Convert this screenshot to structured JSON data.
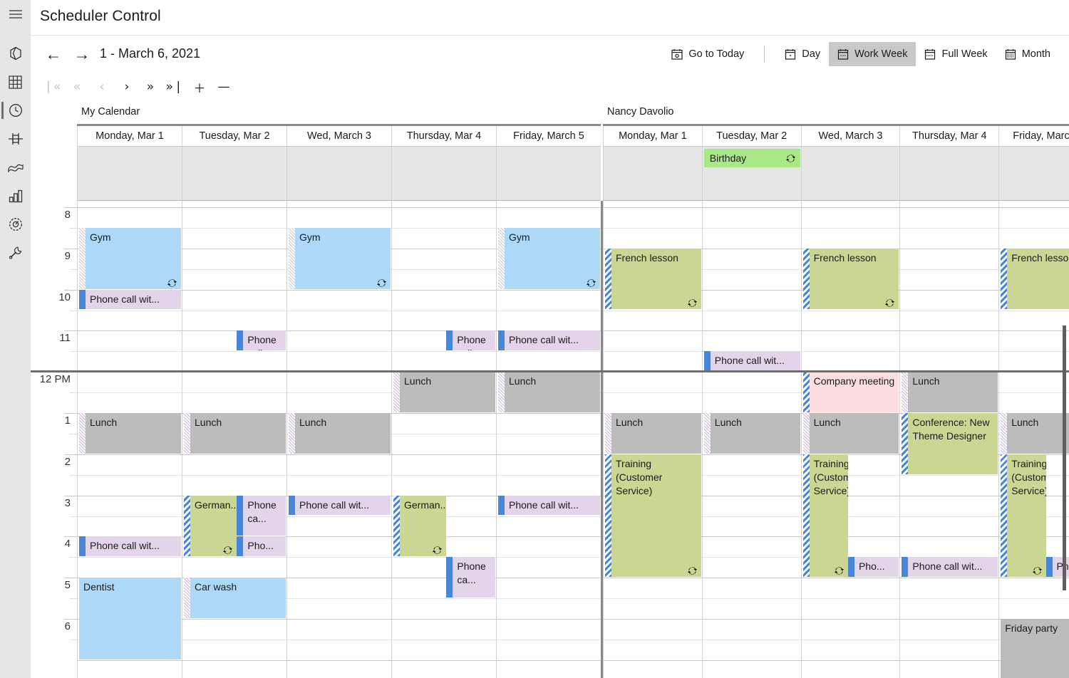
{
  "app": {
    "title": "Scheduler Control"
  },
  "rail": {
    "items": [
      {
        "name": "hamburger-menu-icon",
        "label": "Menu"
      },
      {
        "name": "shapes-icon",
        "label": "Shapes"
      },
      {
        "name": "grid-icon",
        "label": "Grid"
      },
      {
        "name": "clock-icon",
        "label": "Scheduler",
        "selected": true
      },
      {
        "name": "layout-icon",
        "label": "Layout"
      },
      {
        "name": "ribbon-icon",
        "label": "Ribbon"
      },
      {
        "name": "bar-chart-icon",
        "label": "Charts"
      },
      {
        "name": "gauge-icon",
        "label": "Gauge"
      },
      {
        "name": "wrench-icon",
        "label": "Tools"
      }
    ]
  },
  "nav": {
    "prev_label": "←",
    "next_label": "→",
    "range": "1 - March 6, 2021",
    "go_to_today": "Go to Today",
    "views": [
      {
        "label": "Day",
        "icon": "calendar-day-icon",
        "active": false
      },
      {
        "label": "Work Week",
        "icon": "calendar-work-week-icon",
        "active": true
      },
      {
        "label": "Full Week",
        "icon": "calendar-full-week-icon",
        "active": false
      },
      {
        "label": "Month",
        "icon": "calendar-month-icon",
        "active": false
      }
    ]
  },
  "pager": {
    "buttons": [
      {
        "name": "first-page-button",
        "glyph": "❘«",
        "disabled": true
      },
      {
        "name": "prev-block-button",
        "glyph": "«",
        "disabled": true
      },
      {
        "name": "prev-page-button",
        "glyph": "‹",
        "disabled": true
      },
      {
        "name": "next-page-button",
        "glyph": "›",
        "disabled": false
      },
      {
        "name": "next-block-button",
        "glyph": "»",
        "disabled": false
      },
      {
        "name": "last-page-button",
        "glyph": "»❘",
        "disabled": false
      },
      {
        "name": "zoom-in-button",
        "glyph": "＋",
        "disabled": false
      },
      {
        "name": "zoom-out-button",
        "glyph": "—",
        "disabled": false
      }
    ]
  },
  "scheduler": {
    "groups": [
      {
        "id": "mycal",
        "label": "My Calendar"
      },
      {
        "id": "nancy",
        "label": "Nancy Davolio"
      }
    ],
    "days": [
      "Monday, Mar 1",
      "Tuesday, Mar 2",
      "Wed, March 3",
      "Thursday, Mar 4",
      "Friday, March 5"
    ],
    "time_labels": [
      "8",
      "9",
      "10",
      "11",
      "12 PM",
      "1",
      "2",
      "3",
      "4",
      "5",
      "6"
    ],
    "recurrence_icon": "recurrence-icon",
    "colors": {
      "appointment_blue": "#aed8f8",
      "appointment_purple": "#e3d4ea",
      "appointment_gray": "#bcbcbc",
      "appointment_olive": "#ccd693",
      "appointment_pink": "#fbdedd",
      "allday_green": "#a9e887",
      "status_bar_blue": "#4a86d8",
      "selected_view": "#c8c8c8"
    },
    "allday": [
      {
        "group": "nancy",
        "day": 1,
        "title": "Birthday",
        "color": "allday_green",
        "recurring": true
      }
    ],
    "appointments": [
      {
        "group": "mycal",
        "day": 0,
        "title": "Gym",
        "start": "8:30",
        "end": "10:00",
        "color": "blue",
        "bar": "dot-b",
        "recurring": true
      },
      {
        "group": "mycal",
        "day": 2,
        "title": "Gym",
        "start": "8:30",
        "end": "10:00",
        "color": "blue",
        "bar": "dot-b",
        "recurring": true
      },
      {
        "group": "mycal",
        "day": 4,
        "title": "Gym",
        "start": "8:30",
        "end": "10:00",
        "color": "blue",
        "bar": "dot-b",
        "recurring": true
      },
      {
        "group": "mycal",
        "day": 0,
        "title": "Phone call wit...",
        "start": "10:00",
        "end": "10:30",
        "color": "purple",
        "bar": "blue",
        "recurring": false
      },
      {
        "group": "mycal",
        "day": 1,
        "title": "Phone call wit...",
        "start": "11:00",
        "end": "11:30",
        "color": "purple",
        "bar": "blue",
        "recurring": false
      },
      {
        "group": "mycal",
        "day": 3,
        "title": "Phone call wit...",
        "start": "11:00",
        "end": "11:30",
        "color": "purple",
        "bar": "blue",
        "recurring": false
      },
      {
        "group": "mycal",
        "day": 4,
        "title": "Phone call wit...",
        "start": "11:00",
        "end": "11:30",
        "color": "purple",
        "bar": "blue",
        "recurring": false
      },
      {
        "group": "mycal",
        "day": 3,
        "title": "Lunch",
        "start": "12:00",
        "end": "13:00",
        "color": "gray",
        "bar": "dot-p",
        "recurring": false
      },
      {
        "group": "mycal",
        "day": 4,
        "title": "Lunch",
        "start": "12:00",
        "end": "13:00",
        "color": "gray",
        "bar": "dot-p",
        "recurring": false
      },
      {
        "group": "mycal",
        "day": 0,
        "title": "Lunch",
        "start": "13:00",
        "end": "14:00",
        "color": "gray",
        "bar": "dot-p",
        "recurring": false
      },
      {
        "group": "mycal",
        "day": 1,
        "title": "Lunch",
        "start": "13:00",
        "end": "14:00",
        "color": "gray",
        "bar": "dot-p",
        "recurring": false
      },
      {
        "group": "mycal",
        "day": 2,
        "title": "Lunch",
        "start": "13:00",
        "end": "14:00",
        "color": "gray",
        "bar": "dot-p",
        "recurring": false
      },
      {
        "group": "mycal",
        "day": 1,
        "title": "German...",
        "start": "15:00",
        "end": "16:30",
        "color": "olive",
        "bar": "stripe",
        "recurring": true
      },
      {
        "group": "mycal",
        "day": 3,
        "title": "German...",
        "start": "15:00",
        "end": "16:30",
        "color": "olive",
        "bar": "stripe",
        "recurring": true
      },
      {
        "group": "mycal",
        "day": 1,
        "title": "Phone ca...",
        "start": "15:00",
        "end": "16:00",
        "color": "purple",
        "bar": "blue",
        "recurring": false
      },
      {
        "group": "mycal",
        "day": 1,
        "title": "Pho...",
        "start": "16:00",
        "end": "16:30",
        "color": "purple",
        "bar": "blue",
        "recurring": false
      },
      {
        "group": "mycal",
        "day": 2,
        "title": "Phone call wit...",
        "start": "15:00",
        "end": "15:30",
        "color": "purple",
        "bar": "blue",
        "recurring": false
      },
      {
        "group": "mycal",
        "day": 4,
        "title": "Phone call wit...",
        "start": "15:00",
        "end": "15:30",
        "color": "purple",
        "bar": "blue",
        "recurring": false
      },
      {
        "group": "mycal",
        "day": 0,
        "title": "Phone call wit...",
        "start": "16:00",
        "end": "16:30",
        "color": "purple",
        "bar": "blue",
        "recurring": false
      },
      {
        "group": "mycal",
        "day": 3,
        "title": "Phone ca...",
        "start": "16:30",
        "end": "17:30",
        "color": "purple",
        "bar": "blue",
        "recurring": false
      },
      {
        "group": "mycal",
        "day": 0,
        "title": "Dentist",
        "start": "17:00",
        "end": "19:00",
        "color": "blue",
        "bar": "none",
        "recurring": false
      },
      {
        "group": "mycal",
        "day": 1,
        "title": "Car wash",
        "start": "17:00",
        "end": "18:00",
        "color": "blue",
        "bar": "dot-p",
        "recurring": false
      },
      {
        "group": "nancy",
        "day": 0,
        "title": "French lesson",
        "start": "9:00",
        "end": "10:30",
        "color": "olive",
        "bar": "stripe",
        "recurring": true
      },
      {
        "group": "nancy",
        "day": 2,
        "title": "French lesson",
        "start": "9:00",
        "end": "10:30",
        "color": "olive",
        "bar": "stripe",
        "recurring": true
      },
      {
        "group": "nancy",
        "day": 4,
        "title": "French lesson",
        "start": "9:00",
        "end": "10:30",
        "color": "olive",
        "bar": "stripe",
        "recurring": true
      },
      {
        "group": "nancy",
        "day": 1,
        "title": "Phone call wit...",
        "start": "11:30",
        "end": "12:00",
        "color": "purple",
        "bar": "blue",
        "recurring": false
      },
      {
        "group": "nancy",
        "day": 2,
        "title": "Company meeting",
        "start": "12:00",
        "end": "13:00",
        "color": "pink",
        "bar": "stripe",
        "recurring": false
      },
      {
        "group": "nancy",
        "day": 3,
        "title": "Lunch",
        "start": "12:00",
        "end": "13:00",
        "color": "gray",
        "bar": "dot-p",
        "recurring": false
      },
      {
        "group": "nancy",
        "day": 0,
        "title": "Lunch",
        "start": "13:00",
        "end": "14:00",
        "color": "gray",
        "bar": "dot-p",
        "recurring": false
      },
      {
        "group": "nancy",
        "day": 1,
        "title": "Lunch",
        "start": "13:00",
        "end": "14:00",
        "color": "gray",
        "bar": "dot-p",
        "recurring": false
      },
      {
        "group": "nancy",
        "day": 2,
        "title": "Lunch",
        "start": "13:00",
        "end": "14:00",
        "color": "gray",
        "bar": "dot-p",
        "recurring": false
      },
      {
        "group": "nancy",
        "day": 4,
        "title": "Lunch",
        "start": "13:00",
        "end": "14:00",
        "color": "gray",
        "bar": "dot-p",
        "recurring": false
      },
      {
        "group": "nancy",
        "day": 3,
        "title": "Conference: New Theme Designer",
        "start": "13:00",
        "end": "14:30",
        "color": "olive",
        "bar": "stripe",
        "recurring": false
      },
      {
        "group": "nancy",
        "day": 0,
        "title": "Training (Customer Service)",
        "start": "14:00",
        "end": "17:00",
        "color": "olive",
        "bar": "stripe",
        "recurring": true
      },
      {
        "group": "nancy",
        "day": 2,
        "title": "Training (Customer Service)",
        "start": "14:00",
        "end": "17:00",
        "color": "olive",
        "bar": "stripe",
        "recurring": true
      },
      {
        "group": "nancy",
        "day": 4,
        "title": "Training (Customer Service)",
        "start": "14:00",
        "end": "17:00",
        "color": "olive",
        "bar": "stripe",
        "recurring": true
      },
      {
        "group": "nancy",
        "day": 2,
        "title": "Pho...",
        "start": "16:30",
        "end": "17:00",
        "color": "purple",
        "bar": "blue",
        "recurring": false
      },
      {
        "group": "nancy",
        "day": 3,
        "title": "Phone call wit...",
        "start": "16:30",
        "end": "17:00",
        "color": "purple",
        "bar": "blue",
        "recurring": false
      },
      {
        "group": "nancy",
        "day": 4,
        "title": "Pho...",
        "start": "16:30",
        "end": "17:00",
        "color": "purple",
        "bar": "blue",
        "recurring": false
      },
      {
        "group": "nancy",
        "day": 4,
        "title": "Friday party",
        "start": "18:00",
        "end": "19:30",
        "color": "gray",
        "bar": "none",
        "recurring": false
      }
    ]
  }
}
